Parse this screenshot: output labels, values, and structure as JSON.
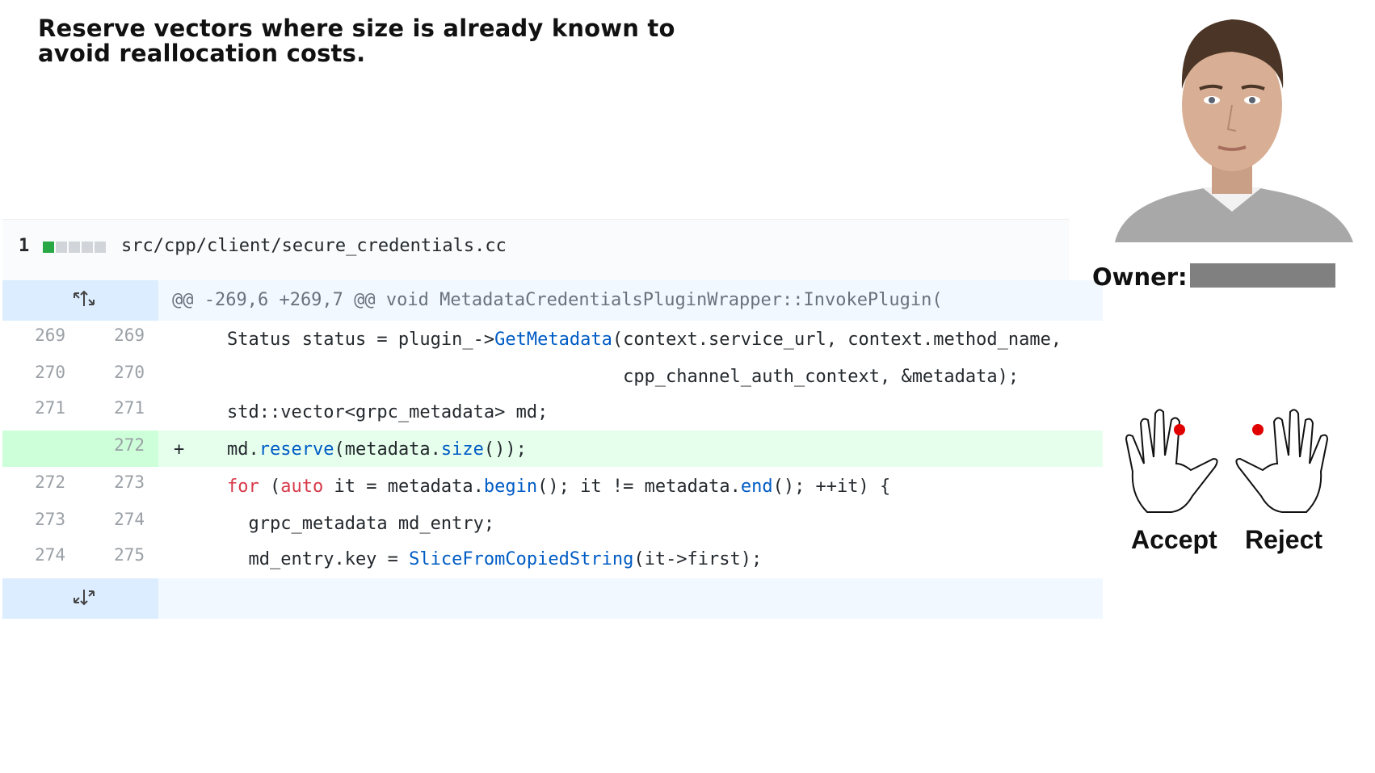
{
  "task": {
    "title": "Reserve vectors where size is already known to avoid reallocation costs."
  },
  "file": {
    "changes": "1",
    "diffstat": [
      "add",
      "neutral",
      "neutral",
      "neutral",
      "neutral"
    ],
    "path": "src/cpp/client/secure_credentials.cc"
  },
  "hunk": {
    "header": "@@ -269,6 +269,7 @@ void MetadataCredentialsPluginWrapper::InvokePlugin("
  },
  "lines": [
    {
      "old": "269",
      "new": "269",
      "type": "context",
      "marker": "",
      "code": "Status status = plugin_->GetMetadata(context.service_url, context.method_name,"
    },
    {
      "old": "270",
      "new": "270",
      "type": "context",
      "marker": "",
      "code": "                                     cpp_channel_auth_context, &metadata);"
    },
    {
      "old": "271",
      "new": "271",
      "type": "context",
      "marker": "",
      "code": "std::vector<grpc_metadata> md;"
    },
    {
      "old": "",
      "new": "272",
      "type": "add",
      "marker": "+",
      "code": "md.reserve(metadata.size());"
    },
    {
      "old": "272",
      "new": "273",
      "type": "context",
      "marker": "",
      "code": "for (auto it = metadata.begin(); it != metadata.end(); ++it) {"
    },
    {
      "old": "273",
      "new": "274",
      "type": "context",
      "marker": "",
      "code": "  grpc_metadata md_entry;"
    },
    {
      "old": "274",
      "new": "275",
      "type": "context",
      "marker": "",
      "code": "  md_entry.key = SliceFromCopiedString(it->first);"
    }
  ],
  "reviewer": {
    "owner_label": "Owner:",
    "owner_value": ""
  },
  "actions": {
    "accept_label": "Accept",
    "reject_label": "Reject"
  },
  "colors": {
    "added_bg": "#e6ffed",
    "hunk_bg": "#f1f8ff",
    "keyword": "#d73a49",
    "function": "#005cc5",
    "marker_dot": "#e00000"
  },
  "icons": {
    "expand_up": "expand-up-icon",
    "expand_down": "expand-down-icon",
    "accept_hand": "hand-icon",
    "reject_hand": "hand-icon"
  }
}
